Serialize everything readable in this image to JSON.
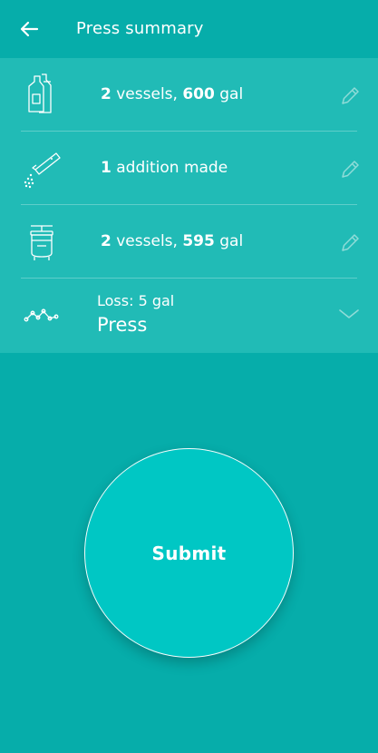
{
  "header": {
    "back_icon": "arrow-left-icon",
    "title": "Press summary"
  },
  "rows": [
    {
      "icon": "vessels-icon",
      "count": "2",
      "mid": " vessels, ",
      "amount": "600",
      "unit": " gal",
      "action_icon": "pencil-icon"
    },
    {
      "icon": "addition-icon",
      "count": "1",
      "mid": " addition made",
      "action_icon": "pencil-icon"
    },
    {
      "icon": "press-icon",
      "count": "2",
      "mid": " vessels, ",
      "amount": "595",
      "unit": " gal",
      "action_icon": "pencil-icon"
    }
  ],
  "loss": {
    "icon": "line-graph-icon",
    "label": "Loss: 5 gal",
    "title": "Press",
    "action_icon": "chevron-down-icon"
  },
  "submit": {
    "label": "Submit"
  },
  "colors": {
    "background": "#06ADAA",
    "list_background": "#21BBB6",
    "submit_fill": "#00C7C4",
    "icon_stroke": "#ffffff",
    "muted_icon": "#8FDCD8"
  }
}
